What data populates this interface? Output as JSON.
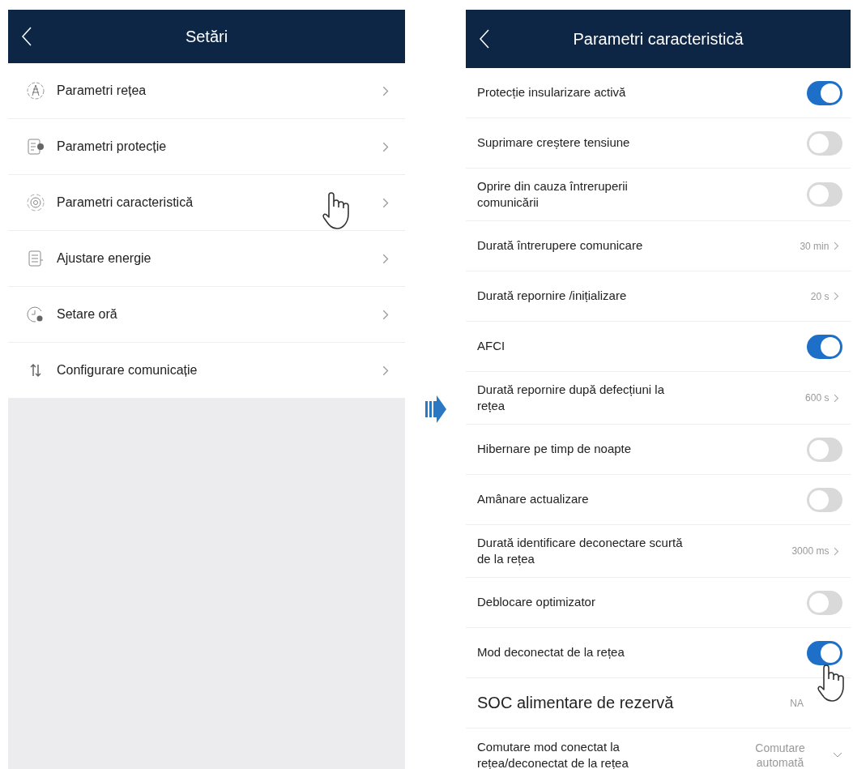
{
  "settings_screen": {
    "title": "Setări",
    "items": [
      {
        "label": "Parametri rețea"
      },
      {
        "label": "Parametri protecție"
      },
      {
        "label": "Parametri caracteristică"
      },
      {
        "label": "Ajustare energie"
      },
      {
        "label": "Setare oră"
      },
      {
        "label": "Configurare comunicație"
      }
    ]
  },
  "detail_screen": {
    "title": "Parametri caracteristică",
    "rows": [
      {
        "kind": "toggle",
        "label": "Protecție insularizare activă",
        "on": true
      },
      {
        "kind": "toggle",
        "label": "Suprimare creștere tensiune",
        "on": false
      },
      {
        "kind": "toggle",
        "label": "Oprire din cauza întreruperii comunicării",
        "on": false
      },
      {
        "kind": "value",
        "label": "Durată întrerupere comunicare",
        "value": "30 min"
      },
      {
        "kind": "value",
        "label": "Durată repornire /inițializare",
        "value": "20 s"
      },
      {
        "kind": "toggle",
        "label": "AFCI",
        "on": true
      },
      {
        "kind": "value",
        "label": "Durată repornire după defecțiuni la rețea",
        "value": "600 s"
      },
      {
        "kind": "toggle",
        "label": "Hibernare pe timp de noapte",
        "on": false
      },
      {
        "kind": "toggle",
        "label": "Amânare actualizare",
        "on": false
      },
      {
        "kind": "value",
        "label": "Durată identificare deconectare scurtă de la rețea",
        "value": "3000 ms"
      },
      {
        "kind": "toggle",
        "label": "Deblocare optimizator",
        "on": false
      },
      {
        "kind": "toggle",
        "label": "Mod deconectat de la rețea",
        "on": true
      },
      {
        "kind": "plain",
        "label": "SOC alimentare de rezervă",
        "value": "NA"
      },
      {
        "kind": "dropdown",
        "label": "Comutare mod conectat la rețea/deconectat de la rețea",
        "value": "Comutare automată"
      }
    ]
  }
}
